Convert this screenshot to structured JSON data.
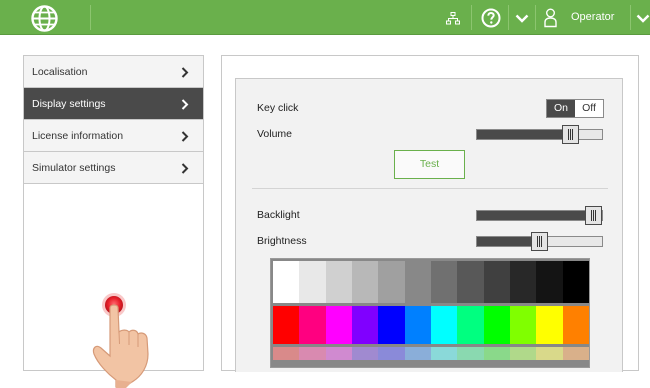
{
  "topbar": {
    "user_label": "Operator",
    "icons": [
      "globe-icon",
      "network-icon",
      "help-icon",
      "chevron-down-icon",
      "user-icon",
      "chevron-down-icon"
    ]
  },
  "menu": {
    "items": [
      {
        "label": "Localisation",
        "active": false
      },
      {
        "label": "Display settings",
        "active": true
      },
      {
        "label": "License information",
        "active": false
      },
      {
        "label": "Simulator settings",
        "active": false
      }
    ]
  },
  "display_settings": {
    "key_click": {
      "label": "Key click",
      "on_label": "On",
      "off_label": "Off",
      "value": "On"
    },
    "volume": {
      "label": "Volume",
      "value_fraction": 0.75
    },
    "test_button": "Test",
    "backlight": {
      "label": "Backlight",
      "value_fraction": 1.0
    },
    "brightness": {
      "label": "Brightness",
      "value_fraction": 0.5
    }
  },
  "palette": {
    "grayscale": [
      "#ffffff",
      "#e8e8e8",
      "#d0d0d0",
      "#b8b8b8",
      "#a0a0a0",
      "#888888",
      "#707070",
      "#585858",
      "#404040",
      "#282828",
      "#141414",
      "#000000"
    ],
    "saturated": [
      "#ff0000",
      "#ff0080",
      "#ff00ff",
      "#8000ff",
      "#0000ff",
      "#0080ff",
      "#00ffff",
      "#00ff80",
      "#00ff00",
      "#80ff00",
      "#ffff00",
      "#ff8000"
    ],
    "pastel": [
      "#d98a8a",
      "#d98ab0",
      "#d08ad0",
      "#a08ad0",
      "#8a8ad9",
      "#8aaed9",
      "#8ad9d9",
      "#8ad9b0",
      "#8ad98a",
      "#b0d98a",
      "#d9d98a",
      "#d9b08a"
    ]
  },
  "colors": {
    "accent": "#6ab04c",
    "active_menu": "#4a4a4a",
    "touch_indicator": "#e8202a"
  }
}
